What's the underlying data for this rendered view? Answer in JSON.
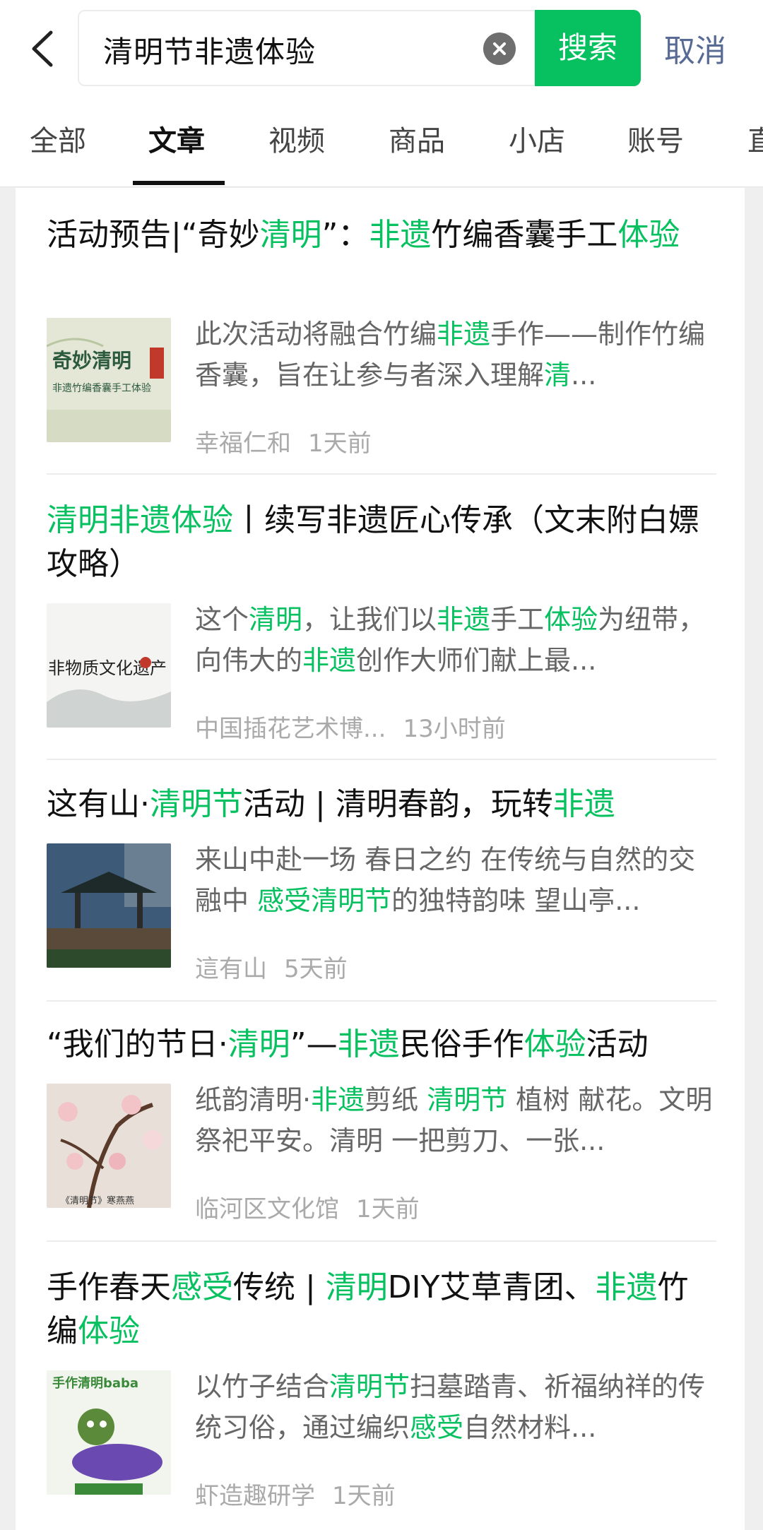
{
  "search": {
    "query": "清明节非遗体验",
    "button_label": "搜索",
    "cancel_label": "取消"
  },
  "tabs": [
    "全部",
    "文章",
    "视频",
    "商品",
    "小店",
    "账号",
    "直"
  ],
  "active_tab": "文章",
  "accent_color": "#07c160",
  "results": [
    {
      "title": "活动预告|“奇妙清明”：非遗竹编香囊手工体验",
      "description": "此次活动将融合竹编非遗手作——制作竹编香囊，旨在让参与者深入理解清...",
      "source": "幸福仁和",
      "time": "1天前",
      "thumb_text": "奇妙清明"
    },
    {
      "title": "清明非遗体验丨续写非遗匠心传承（文末附白嫖攻略）",
      "description": "这个清明，让我们以非遗手工体验为纽带，向伟大的非遗创作大师们献上最...",
      "source": "中国插花艺术博...",
      "time": "13小时前",
      "thumb_text": "非物质文化遗产"
    },
    {
      "title": "这有山·清明节活动 | 清明春韵，玩转非遗",
      "description": "来山中赴一场 春日之约 在传统与自然的交融中 感受清明节的独特韵味 望山亭...",
      "source": "這有山",
      "time": "5天前"
    },
    {
      "title": "“我们的节日·清明”—非遗民俗手作体验活动",
      "description": "纸韵清明·非遗剪纸 清明节 植树 献花。文明祭祀平安。清明 一把剪刀、一张...",
      "source": "临河区文化馆",
      "time": "1天前",
      "thumb_text": "《清明节》寒燕燕"
    },
    {
      "title": "手作春天感受传统 | 清明DIY艾草青团、非遗竹编体验",
      "description": "以竹子结合清明节扫墓踏青、祈福纳祥的传统习俗，通过编织感受自然材料...",
      "source": "虾造趣研学",
      "time": "1天前",
      "thumb_text": "手作清明baba"
    }
  ]
}
